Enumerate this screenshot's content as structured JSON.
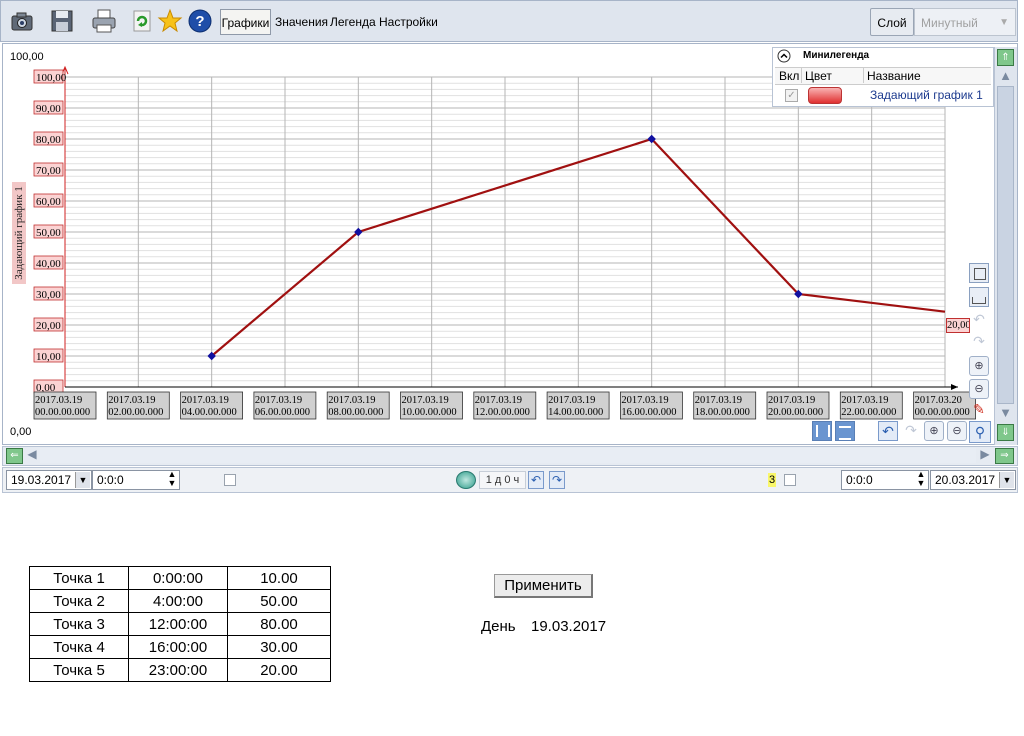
{
  "toolbar": {
    "icons": [
      "camera-icon",
      "save-icon",
      "print-icon",
      "refresh-icon",
      "star-icon",
      "help-icon"
    ],
    "tabs": [
      "Графики",
      "Значения",
      "Легенда",
      "Настройки"
    ],
    "layer_button": "Слой",
    "period_select": "Минутный"
  },
  "chart": {
    "y_max_label": "100,00",
    "y_min_label": "0,00",
    "y_axis_title": "Задающий график 1",
    "last_value_label": "20,00"
  },
  "minilegend": {
    "title": "Минилегенда",
    "headers": [
      "Вкл",
      "Цвет",
      "Название"
    ],
    "rows": [
      {
        "enabled": true,
        "color": "#e03030",
        "name": "Задающий график 1"
      }
    ]
  },
  "bottombar": {
    "start_date": "19.03.2017",
    "start_time": "0:0:0",
    "range_label": "1 д 0 ч",
    "count_label": "3",
    "end_time": "0:0:0",
    "end_date": "20.03.2017"
  },
  "chart_data": {
    "type": "line",
    "ylim": [
      0,
      100
    ],
    "yticks": [
      "0,00",
      "10,00",
      "20,00",
      "30,00",
      "40,00",
      "50,00",
      "60,00",
      "70,00",
      "80,00",
      "90,00",
      "100,00"
    ],
    "xticks": [
      [
        "2017.03.19",
        "00.00.00.000"
      ],
      [
        "2017.03.19",
        "02.00.00.000"
      ],
      [
        "2017.03.19",
        "04.00.00.000"
      ],
      [
        "2017.03.19",
        "06.00.00.000"
      ],
      [
        "2017.03.19",
        "08.00.00.000"
      ],
      [
        "2017.03.19",
        "10.00.00.000"
      ],
      [
        "2017.03.19",
        "12.00.00.000"
      ],
      [
        "2017.03.19",
        "14.00.00.000"
      ],
      [
        "2017.03.19",
        "16.00.00.000"
      ],
      [
        "2017.03.19",
        "18.00.00.000"
      ],
      [
        "2017.03.19",
        "20.00.00.000"
      ],
      [
        "2017.03.19",
        "22.00.00.000"
      ],
      [
        "2017.03.20",
        "00.00.00.000"
      ]
    ],
    "series": [
      {
        "name": "Задающий график 1",
        "color": "#a01010",
        "x_hours": [
          4,
          8,
          16,
          20,
          27
        ],
        "y": [
          10,
          50,
          80,
          30,
          20
        ]
      }
    ]
  },
  "points_table": [
    [
      "Точка 1",
      "0:00:00",
      "10.00"
    ],
    [
      "Точка 2",
      "4:00:00",
      "50.00"
    ],
    [
      "Точка 3",
      "12:00:00",
      "80.00"
    ],
    [
      "Точка 4",
      "16:00:00",
      "30.00"
    ],
    [
      "Точка 5",
      "23:00:00",
      "20.00"
    ]
  ],
  "apply_button": "Применить",
  "day_label": "День",
  "day_value": "19.03.2017"
}
